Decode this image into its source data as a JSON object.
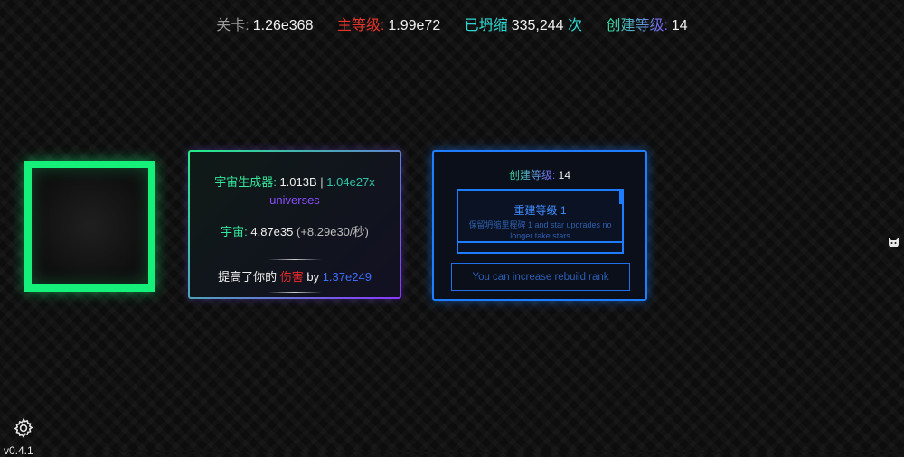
{
  "stats": {
    "level_label": "关卡:",
    "level_value": "1.26e368",
    "main_level_label": "主等级:",
    "main_level_value": "1.99e72",
    "collapsed_label": "已坍缩",
    "collapsed_value": "335,244",
    "collapsed_unit": "次",
    "creation_level_label": "创建等级:",
    "creation_level_value": "14"
  },
  "universe_card": {
    "generator_label": "宇宙生成器:",
    "generator_value": "1.013B",
    "generator_sep": "|",
    "generator_multiplier": "1.04e27x",
    "generator_unit": "universes",
    "universe_label": "宇宙:",
    "universe_value": "4.87e35",
    "universe_rate": "(+8.29e30/秒)",
    "boost_prefix": "提高了你的",
    "boost_damage": "伤害",
    "boost_by": "by",
    "boost_value": "1.37e249"
  },
  "rebuild_card": {
    "title_label": "创建等级:",
    "title_value": "14",
    "upgrade_title": "重建等级 1",
    "upgrade_desc": "保留坍缩里程碑 1 and star upgrades no longer take stars",
    "button_label": "You can increase rebuild rank"
  },
  "footer": {
    "version": "v0.4.1"
  },
  "colors": {
    "green": "#14f07a",
    "blue": "#1e7cff",
    "red": "#e8352b",
    "cyan": "#2ed8d0",
    "purple": "#7d5cff"
  },
  "icons": {
    "settings": "gear-icon",
    "side": "cat-icon"
  }
}
